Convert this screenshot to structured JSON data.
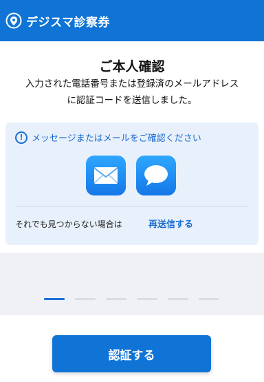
{
  "header": {
    "brand": "デジスマ診察券"
  },
  "main": {
    "title": "ご本人確認",
    "description": [
      "入力された電話番号または登録済のメールアドレス",
      "に認証コードを送信しました。"
    ],
    "notice": "メッセージまたはメールをご確認ください",
    "not_found": "それでも見つからない場合は",
    "resend": "再送信する"
  },
  "icons": {
    "brand": "brand-logo-icon",
    "alert": "alert-circle-icon",
    "mail": "mail-app-icon",
    "messages": "messages-app-icon"
  },
  "steps": {
    "total": 6,
    "current": 1
  },
  "footer": {
    "button": "認証する"
  },
  "colors": {
    "primary": "#0f74d6",
    "accent_text": "#1a6cd1",
    "card_bg": "#e8f0fb",
    "page_bg": "#f0f1f5"
  }
}
